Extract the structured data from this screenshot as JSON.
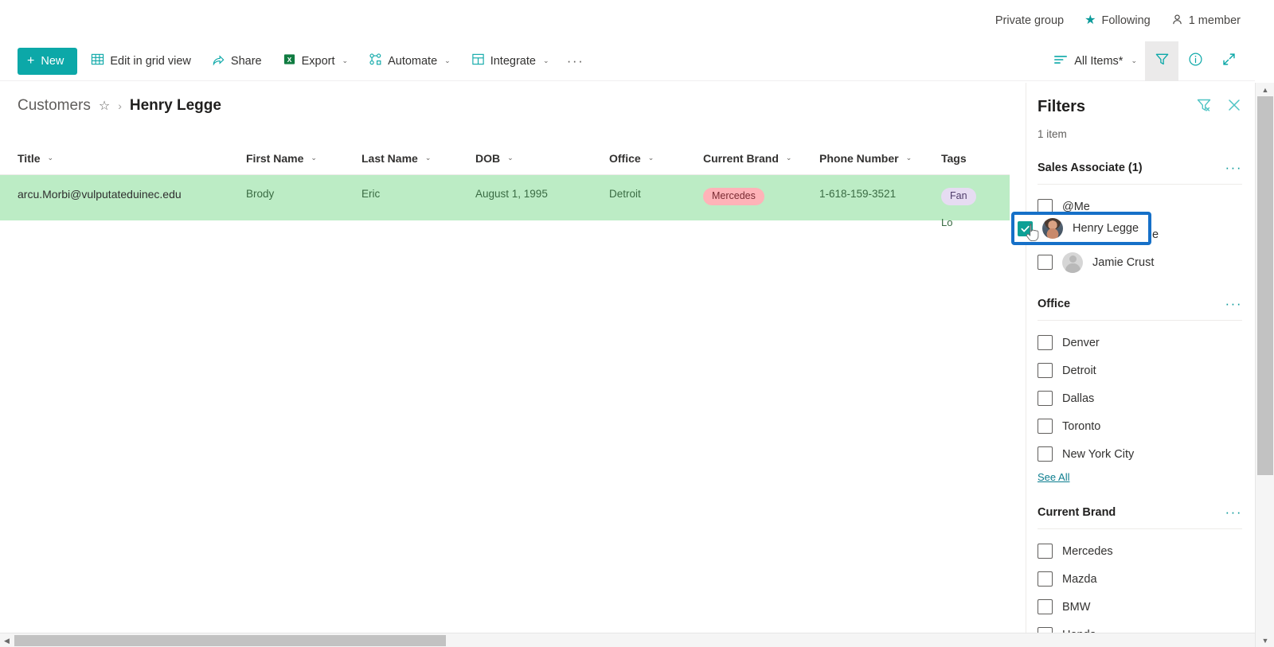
{
  "sitebar": {
    "privacy_label": "Private group",
    "following_label": "Following",
    "members_label": "1 member",
    "star_icon": "star-filled-icon",
    "person_icon": "person-icon"
  },
  "commandbar": {
    "new_label": "New",
    "new_plus": "+",
    "items": [
      {
        "label": "Edit in grid view",
        "icon": "grid-icon",
        "caret": ""
      },
      {
        "label": "Share",
        "icon": "share-icon",
        "caret": ""
      },
      {
        "label": "Export",
        "icon": "excel-icon",
        "caret": "⌄"
      },
      {
        "label": "Automate",
        "icon": "automate-icon",
        "caret": "⌄"
      },
      {
        "label": "Integrate",
        "icon": "integrate-icon",
        "caret": "⌄"
      }
    ],
    "overflow_label": "···",
    "view_label": "All Items*",
    "view_icon": "view-list-icon",
    "view_caret": "⌄",
    "filter_icon": "filter-icon",
    "info_icon": "info-icon",
    "expand_icon": "expand-icon",
    "accent_color": "#0ca8a8"
  },
  "breadcrumb": {
    "root": "Customers",
    "star_icon": "star-outline-icon",
    "separator": "›",
    "current": "Henry Legge"
  },
  "list": {
    "columns": [
      {
        "label": "Title",
        "key": "title",
        "class": "c-title"
      },
      {
        "label": "First Name",
        "key": "first",
        "class": "c-first"
      },
      {
        "label": "Last Name",
        "key": "last",
        "class": "c-last"
      },
      {
        "label": "DOB",
        "key": "dob",
        "class": "c-dob"
      },
      {
        "label": "Office",
        "key": "office",
        "class": "c-office"
      },
      {
        "label": "Current Brand",
        "key": "brand",
        "class": "c-brand"
      },
      {
        "label": "Phone Number",
        "key": "phone",
        "class": "c-phone"
      },
      {
        "label": "Tags",
        "key": "tags",
        "class": "c-tags"
      }
    ],
    "sort_caret": "⌄",
    "row": {
      "title": "arcu.Morbi@vulputateduinec.edu",
      "first": "Brody",
      "last": "Eric",
      "dob": "August 1, 1995",
      "office": "Detroit",
      "brand": "Mercedes",
      "phone": "1-618-159-3521",
      "tag_primary": "Fan",
      "tag_secondary": "Lo",
      "row_color": "#bcecc5",
      "brand_pill_color": "#ffb3b8",
      "tag_pill_color": "#e6dcf2"
    }
  },
  "filters": {
    "title": "Filters",
    "clear_icon": "clear-filter-icon",
    "close_icon": "close-icon",
    "item_count": "1 item",
    "menu_glyph": "···",
    "groups": [
      {
        "title": "Sales Associate (1)",
        "options": [
          {
            "label": "@Me",
            "checked": false,
            "avatar": "none"
          },
          {
            "label": "Henry Legge",
            "checked": true,
            "avatar": "photo"
          },
          {
            "label": "Jamie Crust",
            "checked": false,
            "avatar": "generic"
          }
        ],
        "see_all": ""
      },
      {
        "title": "Office",
        "options": [
          {
            "label": "Denver",
            "checked": false,
            "avatar": "none"
          },
          {
            "label": "Detroit",
            "checked": false,
            "avatar": "none"
          },
          {
            "label": "Dallas",
            "checked": false,
            "avatar": "none"
          },
          {
            "label": "Toronto",
            "checked": false,
            "avatar": "none"
          },
          {
            "label": "New York City",
            "checked": false,
            "avatar": "none"
          }
        ],
        "see_all": "See All"
      },
      {
        "title": "Current Brand",
        "options": [
          {
            "label": "Mercedes",
            "checked": false,
            "avatar": "none"
          },
          {
            "label": "Mazda",
            "checked": false,
            "avatar": "none"
          },
          {
            "label": "BMW",
            "checked": false,
            "avatar": "none"
          },
          {
            "label": "Honda",
            "checked": false,
            "avatar": "none"
          }
        ],
        "see_all": ""
      }
    ],
    "selected_option_label": "Henry Legge",
    "selection_highlight_color": "#1670c8",
    "checkbox_color": "#0ca095"
  },
  "scrollbars": {
    "v_up": "▲",
    "v_down": "▼",
    "h_left": "◀"
  }
}
